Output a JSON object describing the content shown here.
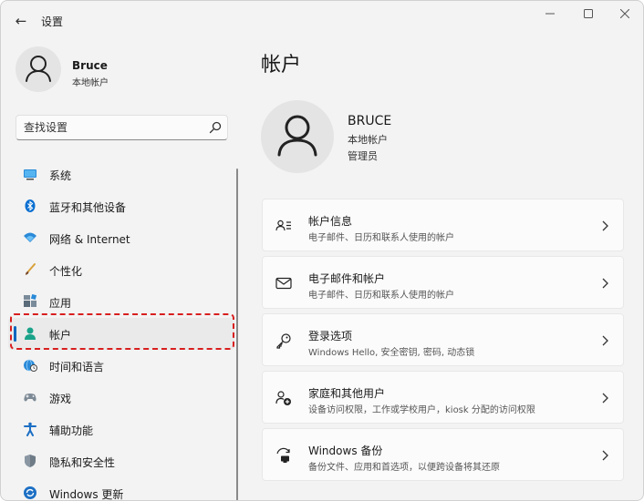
{
  "window": {
    "title": "设置",
    "back_glyph": "←",
    "min_glyph": "—",
    "max_glyph": "☐",
    "close_glyph": "✕"
  },
  "user": {
    "name": "Bruce",
    "type": "本地帐户"
  },
  "search": {
    "placeholder": "查找设置"
  },
  "nav": {
    "items": [
      {
        "label": "系统",
        "icon": "system-icon"
      },
      {
        "label": "蓝牙和其他设备",
        "icon": "bluetooth-icon"
      },
      {
        "label": "网络 & Internet",
        "icon": "network-icon"
      },
      {
        "label": "个性化",
        "icon": "brush-icon"
      },
      {
        "label": "应用",
        "icon": "apps-icon"
      },
      {
        "label": "帐户",
        "icon": "account-icon",
        "active": true
      },
      {
        "label": "时间和语言",
        "icon": "globe-clock-icon"
      },
      {
        "label": "游戏",
        "icon": "gamepad-icon"
      },
      {
        "label": "辅助功能",
        "icon": "accessibility-icon"
      },
      {
        "label": "隐私和安全性",
        "icon": "shield-icon"
      },
      {
        "label": "Windows 更新",
        "icon": "update-icon"
      }
    ]
  },
  "main": {
    "title": "帐户",
    "profile": {
      "name": "BRUCE",
      "type": "本地帐户",
      "role": "管理员"
    },
    "cards": [
      {
        "title": "帐户信息",
        "subtitle": "电子邮件、日历和联系人使用的帐户",
        "icon": "account-info-icon"
      },
      {
        "title": "电子邮件和帐户",
        "subtitle": "电子邮件、日历和联系人使用的帐户",
        "icon": "mail-icon"
      },
      {
        "title": "登录选项",
        "subtitle": "Windows Hello, 安全密钥, 密码, 动态锁",
        "icon": "key-icon"
      },
      {
        "title": "家庭和其他用户",
        "subtitle": "设备访问权限，工作或学校用户，kiosk 分配的访问权限",
        "icon": "family-icon"
      },
      {
        "title": "Windows 备份",
        "subtitle": "备份文件、应用和首选项，以便跨设备将其还原",
        "icon": "backup-icon"
      }
    ]
  },
  "colors": {
    "accent": "#0067c0",
    "highlight": "#d81e1e",
    "background": "#f3f3f3",
    "card": "#fbfbfb"
  }
}
